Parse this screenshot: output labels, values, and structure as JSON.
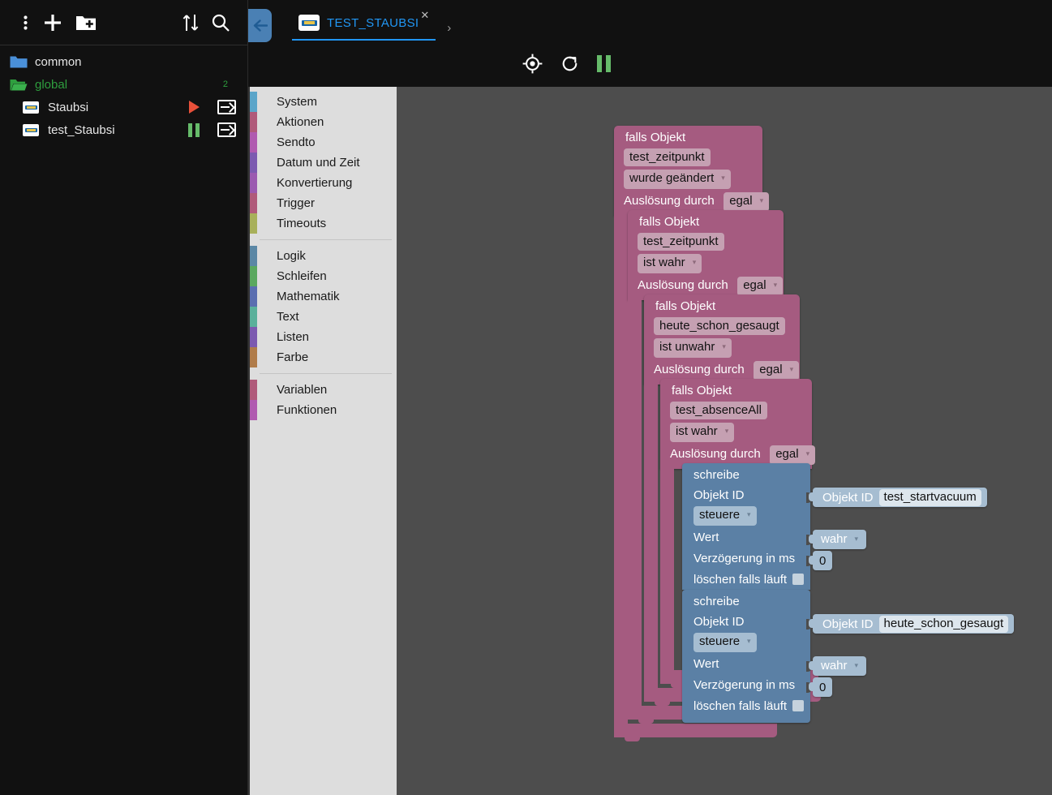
{
  "app": {
    "workspace_bg": "#4d4d4d",
    "panel_bg": "#111111",
    "toolbox_bg": "#dddddd",
    "accent_blue": "#2196f3",
    "block_control_color": "#a55b80",
    "block_action_color": "#5b80a5",
    "value_block_color": "#a6bdd1",
    "run_color": "#e8503a",
    "pause_color": "#66bb6a",
    "folder_color": "#4a90d9",
    "global_color": "#2e9e3e"
  },
  "left_panel": {
    "toolbar": [
      {
        "name": "more-menu-icon",
        "label": "⋮"
      },
      {
        "name": "add-script-icon",
        "label": "+"
      },
      {
        "name": "add-folder-icon",
        "label": "folder-plus"
      },
      {
        "name": "expand-collapse-icon",
        "label": "sort"
      },
      {
        "name": "search-icon",
        "label": "search"
      }
    ],
    "tree": [
      {
        "label": "common",
        "icon": "folder-icon",
        "type": "folder",
        "indent": 0,
        "color": "#ffffff",
        "count": ""
      },
      {
        "label": "global",
        "icon": "folder-open-icon",
        "type": "folder",
        "indent": 0,
        "color": "#2e9e3e",
        "count": "2"
      },
      {
        "label": "Staubsi",
        "icon": "script-icon",
        "type": "script",
        "indent": 1,
        "color": "#e6e6e6",
        "state": "running"
      },
      {
        "label": "test_Staubsi",
        "icon": "script-icon",
        "type": "script",
        "indent": 1,
        "color": "#e6e6e6",
        "state": "paused"
      }
    ]
  },
  "topbar": {
    "back_label": "←",
    "tab": {
      "title": "TEST_STAUBSI",
      "close_label": "✕",
      "more_label": "›"
    },
    "editor_tools": [
      {
        "name": "center-block-icon",
        "label": "target"
      },
      {
        "name": "reload-icon",
        "label": "reload"
      },
      {
        "name": "pause-icon",
        "label": "pause"
      }
    ]
  },
  "toolbox": {
    "groups": [
      {
        "items": [
          {
            "label": "System",
            "color": "#5ba5c9"
          },
          {
            "label": "Aktionen",
            "color": "#b05a7a"
          },
          {
            "label": "Sendto",
            "color": "#b05ab0"
          },
          {
            "label": "Datum und Zeit",
            "color": "#7c5ab0"
          },
          {
            "label": "Konvertierung",
            "color": "#9b5ab0"
          },
          {
            "label": "Trigger",
            "color": "#b05a7a"
          },
          {
            "label": "Timeouts",
            "color": "#a8b05a"
          }
        ]
      },
      {
        "items": [
          {
            "label": "Logik",
            "color": "#5b87a5"
          },
          {
            "label": "Schleifen",
            "color": "#5aa85f"
          },
          {
            "label": "Mathematik",
            "color": "#5a6eb0"
          },
          {
            "label": "Text",
            "color": "#5ab09b"
          },
          {
            "label": "Listen",
            "color": "#7c5ab0"
          },
          {
            "label": "Farbe",
            "color": "#b07c4a"
          }
        ]
      },
      {
        "items": [
          {
            "label": "Variablen",
            "color": "#b05a7a"
          },
          {
            "label": "Funktionen",
            "color": "#b05ab0"
          }
        ]
      }
    ]
  },
  "workspace": {
    "blocks": [
      {
        "id": "if1",
        "type": "on-change",
        "title": "falls Objekt",
        "object_id": "test_zeitpunkt",
        "condition": "wurde geändert",
        "trigger_label": "Auslösung durch",
        "trigger_value": "egal"
      },
      {
        "id": "if2",
        "type": "on-change",
        "title": "falls Objekt",
        "object_id": "test_zeitpunkt",
        "condition": "ist wahr",
        "trigger_label": "Auslösung durch",
        "trigger_value": "egal"
      },
      {
        "id": "if3",
        "type": "on-change",
        "title": "falls Objekt",
        "object_id": "heute_schon_gesaugt",
        "condition": "ist unwahr",
        "trigger_label": "Auslösung durch",
        "trigger_value": "egal"
      },
      {
        "id": "if4",
        "type": "on-change",
        "title": "falls Objekt",
        "object_id": "test_absenceAll",
        "condition": "ist wahr",
        "trigger_label": "Auslösung durch",
        "trigger_value": "egal"
      }
    ],
    "write_blocks": [
      {
        "id": "write1",
        "title": "schreibe",
        "objekt_id_label": "Objekt ID",
        "mode": "steuere",
        "wert_label": "Wert",
        "wert_value": "wahr",
        "delay_label": "Verzögerung in ms",
        "delay_value": "0",
        "clear_label": "löschen falls läuft",
        "clear_checked": false,
        "value_block": {
          "label": "Objekt ID",
          "value": "test_startvacuum"
        }
      },
      {
        "id": "write2",
        "title": "schreibe",
        "objekt_id_label": "Objekt ID",
        "mode": "steuere",
        "wert_label": "Wert",
        "wert_value": "wahr",
        "delay_label": "Verzögerung in ms",
        "delay_value": "0",
        "clear_label": "löschen falls läuft",
        "clear_checked": false,
        "value_block": {
          "label": "Objekt ID",
          "value": "heute_schon_gesaugt"
        }
      }
    ]
  }
}
